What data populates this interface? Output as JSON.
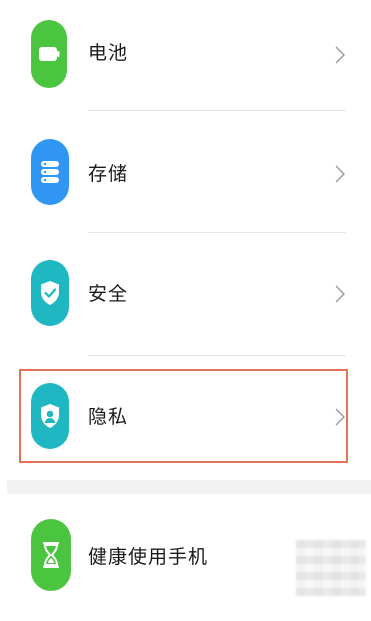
{
  "settings": {
    "items": [
      {
        "label": "电池",
        "icon": "battery-icon",
        "color": "#4bc43f"
      },
      {
        "label": "存储",
        "icon": "storage-icon",
        "color": "#2f96f3"
      },
      {
        "label": "安全",
        "icon": "shield-check-icon",
        "color": "#1fb7c2"
      },
      {
        "label": "隐私",
        "icon": "privacy-icon",
        "color": "#1fb7c2"
      },
      {
        "label": "健康使用手机",
        "icon": "hourglass-icon",
        "color": "#4bc43f"
      }
    ],
    "highlight_color": "#e8735a"
  }
}
